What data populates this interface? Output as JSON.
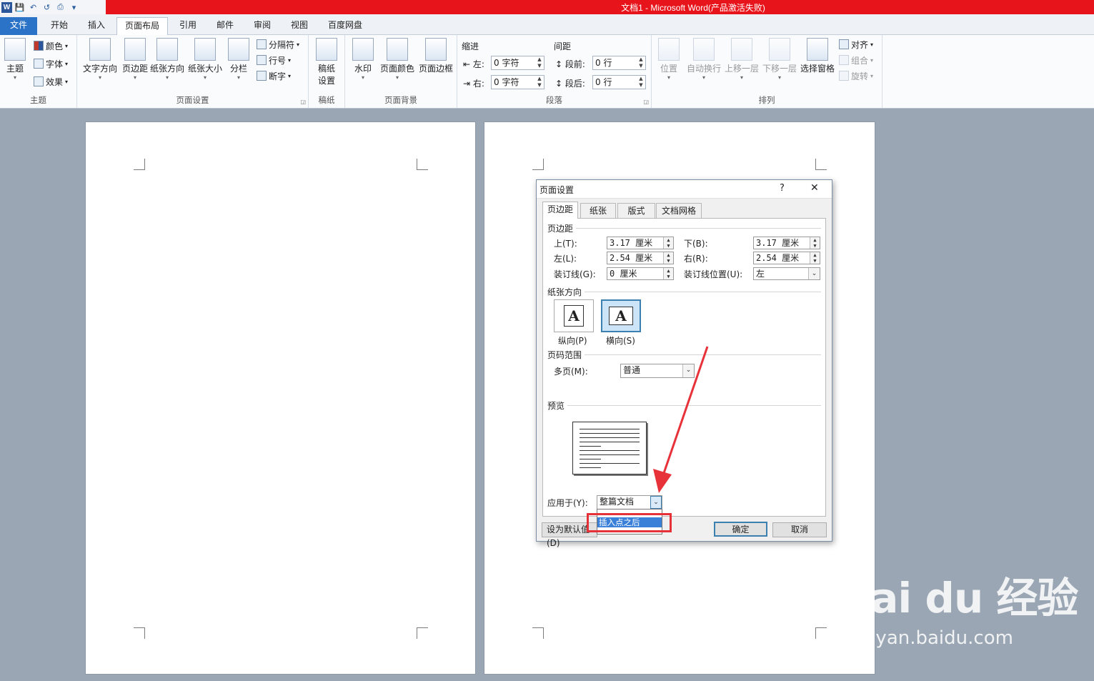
{
  "window_title": "文档1  -  Microsoft Word(产品激活失败)",
  "quick_access": {
    "app_logo": "W",
    "save_icon": "💾",
    "undo_icon": "↶",
    "redo_icon": "↺",
    "print_icon": "⎙",
    "customize_icon": "▾"
  },
  "tabs": [
    "文件",
    "开始",
    "插入",
    "页面布局",
    "引用",
    "邮件",
    "审阅",
    "视图",
    "百度网盘"
  ],
  "ribbon": {
    "theme_group": {
      "label": "主题",
      "theme_button": "主题",
      "colors": "颜色",
      "fonts": "字体",
      "effects": "效果"
    },
    "page_setup_group": {
      "label": "页面设置",
      "text_direction": "文字方向",
      "margins": "页边距",
      "orientation": "纸张方向",
      "size": "纸张大小",
      "columns": "分栏",
      "breaks": "分隔符",
      "line_numbers": "行号",
      "hyphenation": "断字"
    },
    "draft_group": {
      "label": "稿纸",
      "draft_setup_line1": "稿纸",
      "draft_setup_line2": "设置"
    },
    "background_group": {
      "label": "页面背景",
      "watermark": "水印",
      "page_color": "页面颜色",
      "page_borders": "页面边框"
    },
    "paragraph_group": {
      "label": "段落",
      "indent_title": "缩进",
      "indent_left_label": "左:",
      "indent_left_value": "0 字符",
      "indent_right_label": "右:",
      "indent_right_value": "0 字符",
      "spacing_title": "间距",
      "before_label": "段前:",
      "before_value": "0 行",
      "after_label": "段后:",
      "after_value": "0 行"
    },
    "arrange_group": {
      "label": "排列",
      "position": "位置",
      "wrap_text": "自动换行",
      "bring_forward": "上移一层",
      "send_backward": "下移一层",
      "selection_pane": "选择窗格",
      "align": "对齐",
      "group": "组合",
      "rotate": "旋转"
    }
  },
  "dialog": {
    "title": "页面设置",
    "help": "?",
    "close": "✕",
    "tabs": [
      "页边距",
      "纸张",
      "版式",
      "文档网格"
    ],
    "margins_section": "页边距",
    "top_label": "上(T):",
    "top_value": "3.17 厘米",
    "bottom_label": "下(B):",
    "bottom_value": "3.17 厘米",
    "left_label": "左(L):",
    "left_value": "2.54 厘米",
    "right_label": "右(R):",
    "right_value": "2.54 厘米",
    "gutter_label": "装订线(G):",
    "gutter_value": "0 厘米",
    "gutter_pos_label": "装订线位置(U):",
    "gutter_pos_value": "左",
    "orientation_section": "纸张方向",
    "portrait_label": "纵向(P)",
    "landscape_label": "横向(S)",
    "orientation_glyph": "A",
    "pages_section": "页码范围",
    "multiple_pages_label": "多页(M):",
    "multiple_pages_value": "普通",
    "preview_section": "预览",
    "apply_to_label": "应用于(Y):",
    "apply_to_value": "整篇文档",
    "apply_to_option_selected": "插入点之后",
    "set_default_button": "设为默认值(D)",
    "ok_button": "确定",
    "cancel_button": "取消"
  },
  "watermark": {
    "line1": "Bai du 经验",
    "line2": "jingyan.baidu.com"
  }
}
